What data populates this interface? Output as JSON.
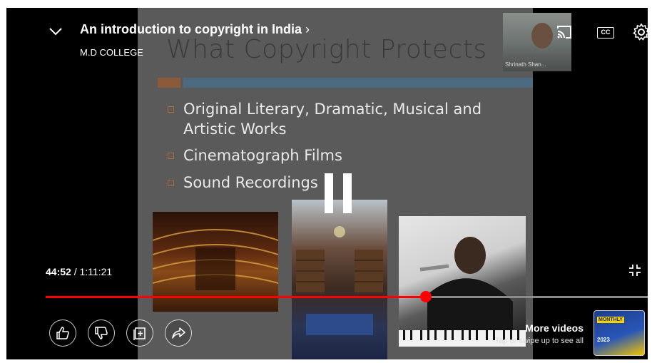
{
  "video": {
    "title": "An introduction to copyright in India",
    "title_chevron": "›",
    "channel": "M.D COLLEGE"
  },
  "slide": {
    "heading": "What Copyright Protects",
    "bullets": [
      "Original Literary, Dramatic, Musical and Artistic Works",
      "Cinematograph Films",
      "Sound Recordings"
    ]
  },
  "speaker": {
    "name": "Shrinath Shan..."
  },
  "controls": {
    "cc_label": "CC",
    "time_current": "44:52",
    "time_separator": " / ",
    "time_total": "1:11:21",
    "progress_fraction": 0.632,
    "state": "playing"
  },
  "more_videos": {
    "title": "More videos",
    "subtitle": "Tap or swipe up to see all",
    "thumb_badge": "MONTHLY",
    "thumb_year": "2023"
  },
  "icons": [
    "chevron-down-icon",
    "cast-icon",
    "cc-icon",
    "settings-icon",
    "pause-icon",
    "fullscreen-exit-icon",
    "thumbs-up-icon",
    "thumbs-down-icon",
    "save-to-playlist-icon",
    "share-icon"
  ],
  "colors": {
    "progress": "#ff0000",
    "background": "#000000"
  }
}
